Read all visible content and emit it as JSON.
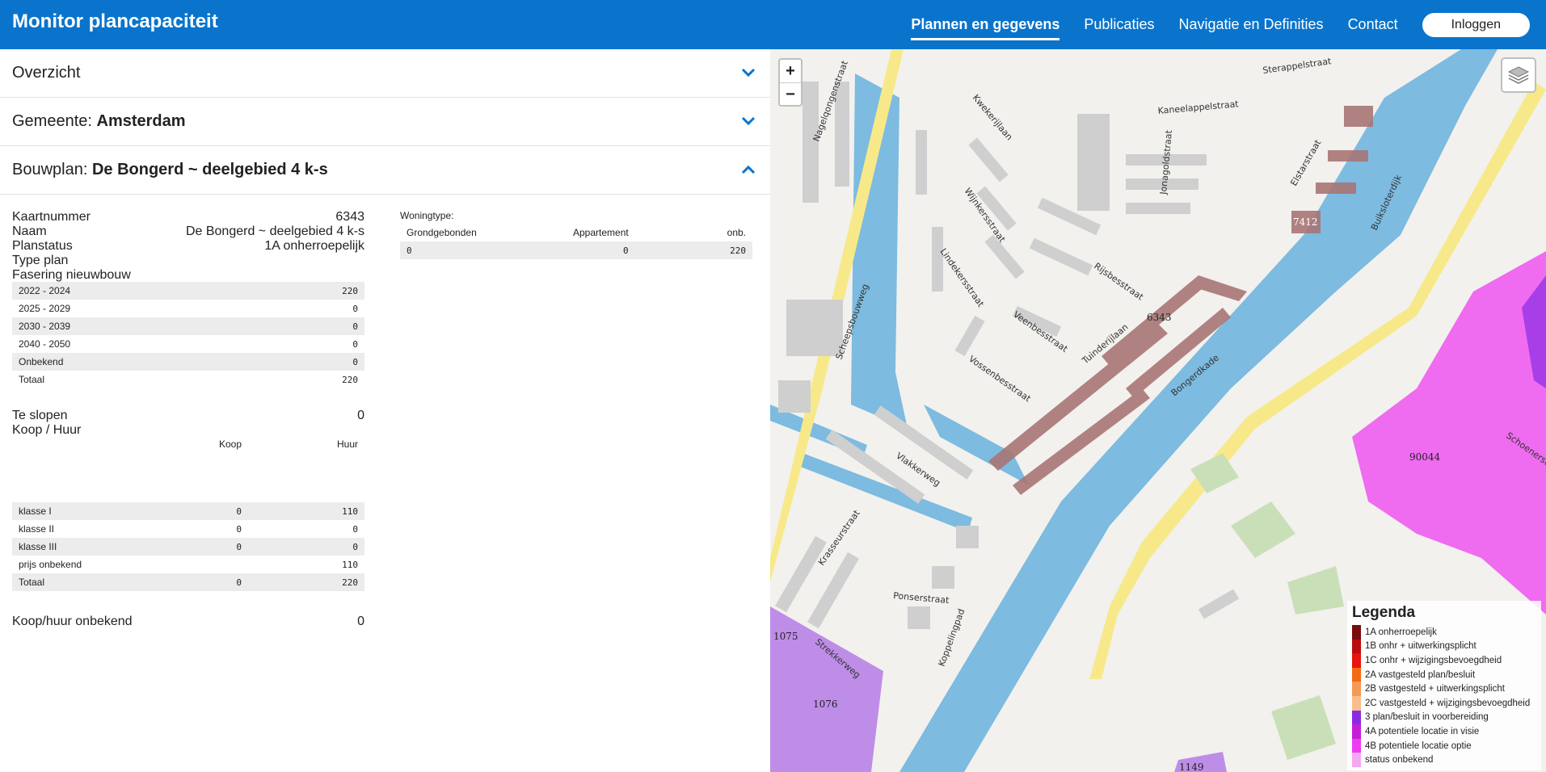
{
  "header": {
    "title": "Monitor plancapaciteit",
    "nav": [
      "Plannen en gegevens",
      "Publicaties",
      "Navigatie en Definities",
      "Contact"
    ],
    "login": "Inloggen"
  },
  "accordion": {
    "overview": "Overzicht",
    "gemeente_label": "Gemeente:",
    "gemeente": "Amsterdam",
    "bouwplan_label": "Bouwplan:",
    "bouwplan": "De Bongerd ~ deelgebied 4 k-s"
  },
  "details": {
    "kaartnummer_label": "Kaartnummer",
    "kaartnummer": "6343",
    "naam_label": "Naam",
    "naam": "De Bongerd ~ deelgebied 4 k-s",
    "planstatus_label": "Planstatus",
    "planstatus": "1A onherroepelijk",
    "typeplan_label": "Type plan",
    "fasering_label": "Fasering nieuwbouw",
    "fasering": [
      {
        "label": "2022 - 2024",
        "value": "220"
      },
      {
        "label": "2025 - 2029",
        "value": "0"
      },
      {
        "label": "2030 - 2039",
        "value": "0"
      },
      {
        "label": "2040 - 2050",
        "value": "0"
      },
      {
        "label": "Onbekend",
        "value": "0"
      },
      {
        "label": "Totaal",
        "value": "220"
      }
    ],
    "teslopen_label": "Te slopen",
    "teslopen": "0",
    "koophuur_label": "Koop / Huur",
    "koop_header": "Koop",
    "huur_header": "Huur",
    "koophuur": [
      {
        "label": "klasse I",
        "koop": "0",
        "huur": "110"
      },
      {
        "label": "klasse II",
        "koop": "0",
        "huur": "0"
      },
      {
        "label": "klasse III",
        "koop": "0",
        "huur": "0"
      },
      {
        "label": "prijs onbekend",
        "koop": "",
        "huur": "110"
      },
      {
        "label": "Totaal",
        "koop": "0",
        "huur": "220"
      }
    ],
    "koophuur_onbekend_label": "Koop/huur onbekend",
    "koophuur_onbekend": "0"
  },
  "woningtype": {
    "label": "Woningtype:",
    "headers": [
      "Grondgebonden",
      "Appartement",
      "onb."
    ],
    "values": [
      "0",
      "0",
      "220"
    ]
  },
  "map": {
    "zoom_in": "+",
    "zoom_out": "−",
    "plan_labels": [
      "6343",
      "7412",
      "90044",
      "1075",
      "1076",
      "1149"
    ],
    "streets": [
      "Nagelqongenstraat",
      "Kwekerijlaan",
      "Kaneelappelstraat",
      "Sterappelstraat",
      "Jonagoldstraat",
      "Elstarstraat",
      "Buiksloterdijk",
      "Wijnkersstraat",
      "Rijsbesstraat",
      "Lindekersstraat",
      "Veenbesstraat",
      "Tuinderijlaan",
      "Bongerdkade",
      "Vossenbesstraat",
      "Scheepsbouwweg",
      "Vlakkerweg",
      "Krasseurstraat",
      "Ponserstraat",
      "Koppelingpad",
      "Strekkerweg",
      "Schoenerstraat"
    ],
    "legend_title": "Legenda",
    "legend": [
      {
        "label": "1A onherroepelijk",
        "color": "#7a0b0b"
      },
      {
        "label": "1B onhr + uitwerkingsplicht",
        "color": "#b80d0d"
      },
      {
        "label": "1C onhr + wijzigingsbevoegdheid",
        "color": "#e8140e"
      },
      {
        "label": "2A vastgesteld plan/besluit",
        "color": "#f26b12"
      },
      {
        "label": "2B vastgesteld + uitwerkingsplicht",
        "color": "#f59a55"
      },
      {
        "label": "2C vastgesteld + wijzigingsbevoegdheid",
        "color": "#f7bd8c"
      },
      {
        "label": "3 plan/besluit in voorbereiding",
        "color": "#8a2be2"
      },
      {
        "label": "4A potentiele locatie in visie",
        "color": "#c51fd6"
      },
      {
        "label": "4B potentiele locatie optie",
        "color": "#ef3cf0"
      },
      {
        "label": "status onbekend",
        "color": "#f3a8f2"
      }
    ]
  }
}
